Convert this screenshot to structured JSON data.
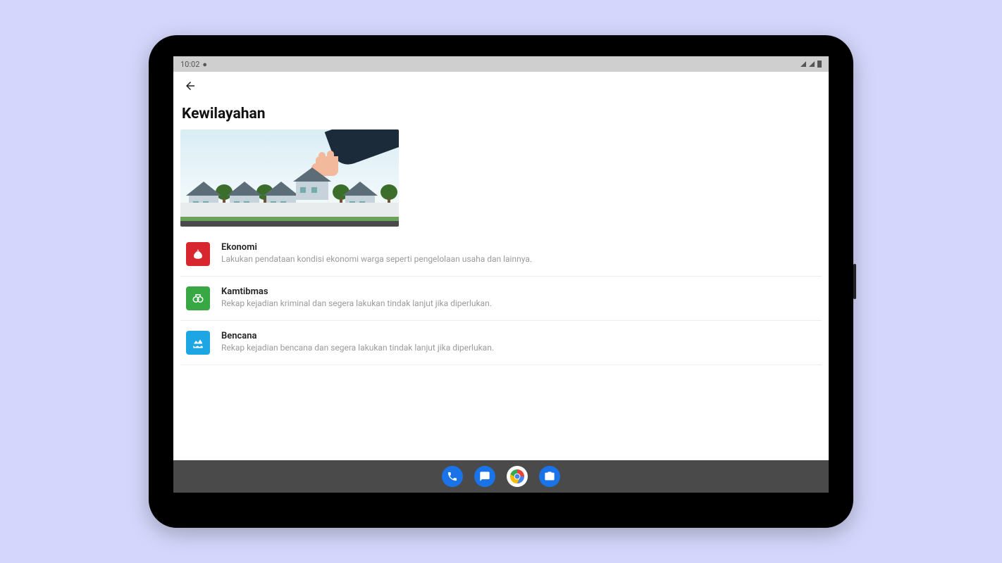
{
  "status": {
    "time": "10:02",
    "icons_right": [
      "wifi",
      "signal",
      "battery"
    ]
  },
  "appbar": {
    "back_label": "Back"
  },
  "page": {
    "title": "Kewilayahan"
  },
  "banner": {
    "alt": "Illustration of a hand placing a house among other houses"
  },
  "items": [
    {
      "icon": "money-bag-icon",
      "icon_color": "red",
      "title": "Ekonomi",
      "desc": "Lakukan pendataan kondisi ekonomi warga seperti pengelolaan usaha dan lainnya."
    },
    {
      "icon": "handcuff-icon",
      "icon_color": "green",
      "title": "Kamtibmas",
      "desc": "Rekap kejadian kriminal dan segera lakukan tindak lanjut jika diperlukan."
    },
    {
      "icon": "flood-icon",
      "icon_color": "blue",
      "title": "Bencana",
      "desc": "Rekap kejadian bencana dan segera lakukan tindak lanjut jika diperlukan."
    }
  ],
  "dock": {
    "phone": "Phone",
    "messages": "Messages",
    "chrome": "Chrome",
    "camera": "Camera"
  }
}
